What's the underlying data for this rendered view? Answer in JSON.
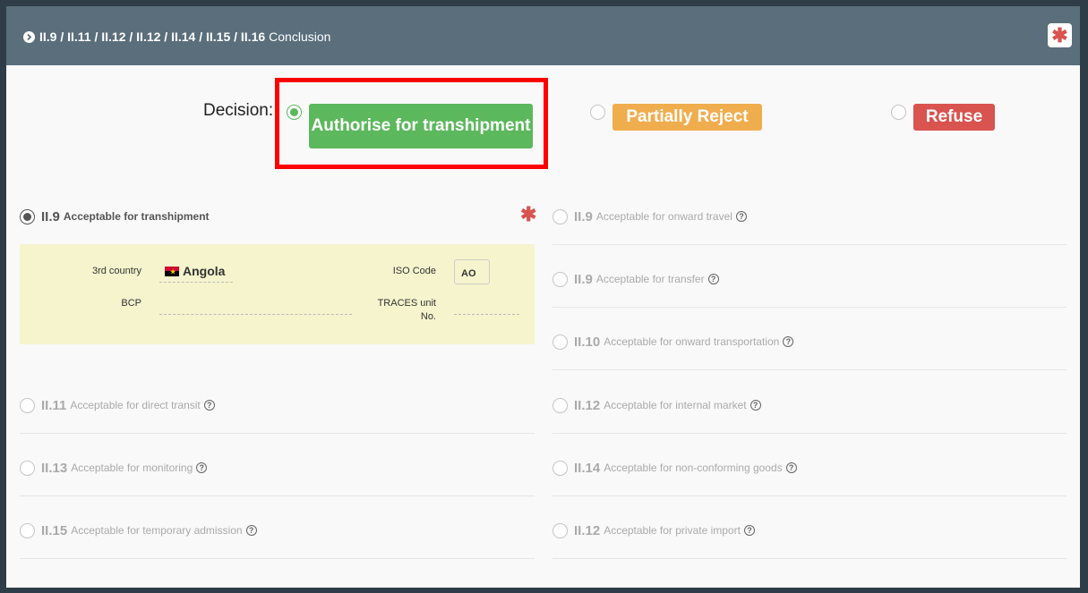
{
  "header": {
    "codes": "II.9 / II.11 / II.12 / II.12 / II.14 / II.15 / II.16",
    "title": "Conclusion",
    "required_symbol": "✱"
  },
  "decision": {
    "label": "Decision:",
    "options": [
      {
        "label": "Authorise for transhipment",
        "color": "#5cb85c",
        "selected": true
      },
      {
        "label": "Partially Reject",
        "color": "#f0ad4e",
        "selected": false
      },
      {
        "label": "Refuse",
        "color": "#d9534f",
        "selected": false
      }
    ]
  },
  "required_star": "✱",
  "left_options": [
    {
      "code": "II.9",
      "label": "Acceptable for transhipment",
      "selected": true,
      "help": false
    },
    {
      "code": "II.11",
      "label": "Acceptable for direct transit",
      "selected": false,
      "help": true
    },
    {
      "code": "II.13",
      "label": "Acceptable for monitoring",
      "selected": false,
      "help": true
    },
    {
      "code": "II.15",
      "label": "Acceptable for temporary admission",
      "selected": false,
      "help": true
    }
  ],
  "right_options": [
    {
      "code": "II.9",
      "label": "Acceptable for onward travel",
      "help": true
    },
    {
      "code": "II.9",
      "label": "Acceptable for transfer",
      "help": true
    },
    {
      "code": "II.10",
      "label": "Acceptable for onward transportation",
      "help": true
    },
    {
      "code": "II.12",
      "label": "Acceptable for internal market",
      "help": true
    },
    {
      "code": "II.14",
      "label": "Acceptable for non-conforming goods",
      "help": true
    },
    {
      "code": "II.12",
      "label": "Acceptable for private import",
      "help": true
    }
  ],
  "transhipment_details": {
    "third_country_label": "3rd country",
    "third_country_value": "Angola",
    "flag_icon": "angola-flag-icon",
    "iso_code_label": "ISO Code",
    "iso_code_value": "AO",
    "bcp_label": "BCP",
    "bcp_value": "",
    "traces_unit_label_line1": "TRACES unit",
    "traces_unit_label_line2": "No.",
    "traces_unit_value": ""
  },
  "help_icon_glyph": "?"
}
